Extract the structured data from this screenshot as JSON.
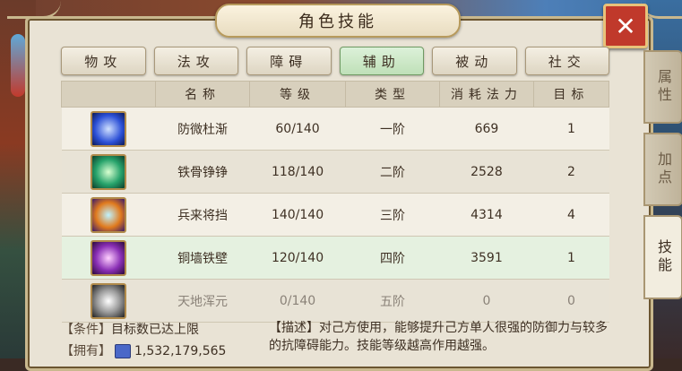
{
  "title": "角色技能",
  "close_label": "✕",
  "tabs": [
    {
      "label": "物攻",
      "active": false
    },
    {
      "label": "法攻",
      "active": false
    },
    {
      "label": "障碍",
      "active": false
    },
    {
      "label": "辅助",
      "active": true
    },
    {
      "label": "被动",
      "active": false
    },
    {
      "label": "社交",
      "active": false
    }
  ],
  "table": {
    "headers": [
      "",
      "名称",
      "等级",
      "类型",
      "消耗法力",
      "目标"
    ],
    "rows": [
      {
        "icon": "blue-wing-skill-icon",
        "name": "防微杜渐",
        "level": "60/140",
        "type": "一阶",
        "mana": "669",
        "target": "1",
        "icon_color": "#2b4fd6"
      },
      {
        "icon": "green-bone-skill-icon",
        "name": "铁骨铮铮",
        "level": "118/140",
        "type": "二阶",
        "mana": "2528",
        "target": "2",
        "icon_color": "#27a36b"
      },
      {
        "icon": "orange-shield-skill-icon",
        "name": "兵来将挡",
        "level": "140/140",
        "type": "三阶",
        "mana": "4314",
        "target": "4",
        "icon_color": "#e07a1d"
      },
      {
        "icon": "purple-wall-skill-icon",
        "name": "铜墙铁壁",
        "level": "120/140",
        "type": "四阶",
        "mana": "3591",
        "target": "1",
        "icon_color": "#8a2fb5"
      },
      {
        "icon": "white-light-skill-icon",
        "name": "天地浑元",
        "level": "0/140",
        "type": "五阶",
        "mana": "0",
        "target": "0",
        "icon_color": "#9a9a9a"
      }
    ]
  },
  "footer": {
    "condition_tag": "【条件】",
    "condition_text": "目标数已达上限",
    "owned_tag": "【拥有】",
    "owned_value": "1,532,179,565",
    "desc_tag": "【描述】",
    "desc_text": "对己方使用，能够提升己方单人很强的防御力与较多的抗障碍能力。技能等级越高作用越强。"
  },
  "side_tabs": [
    {
      "label": "属性",
      "active": false
    },
    {
      "label": "加点",
      "active": false
    },
    {
      "label": "技能",
      "active": true
    }
  ],
  "colors": {
    "active_tab": "#bfe0b8",
    "close_button": "#c0392b",
    "panel": "#e9e3d5"
  }
}
